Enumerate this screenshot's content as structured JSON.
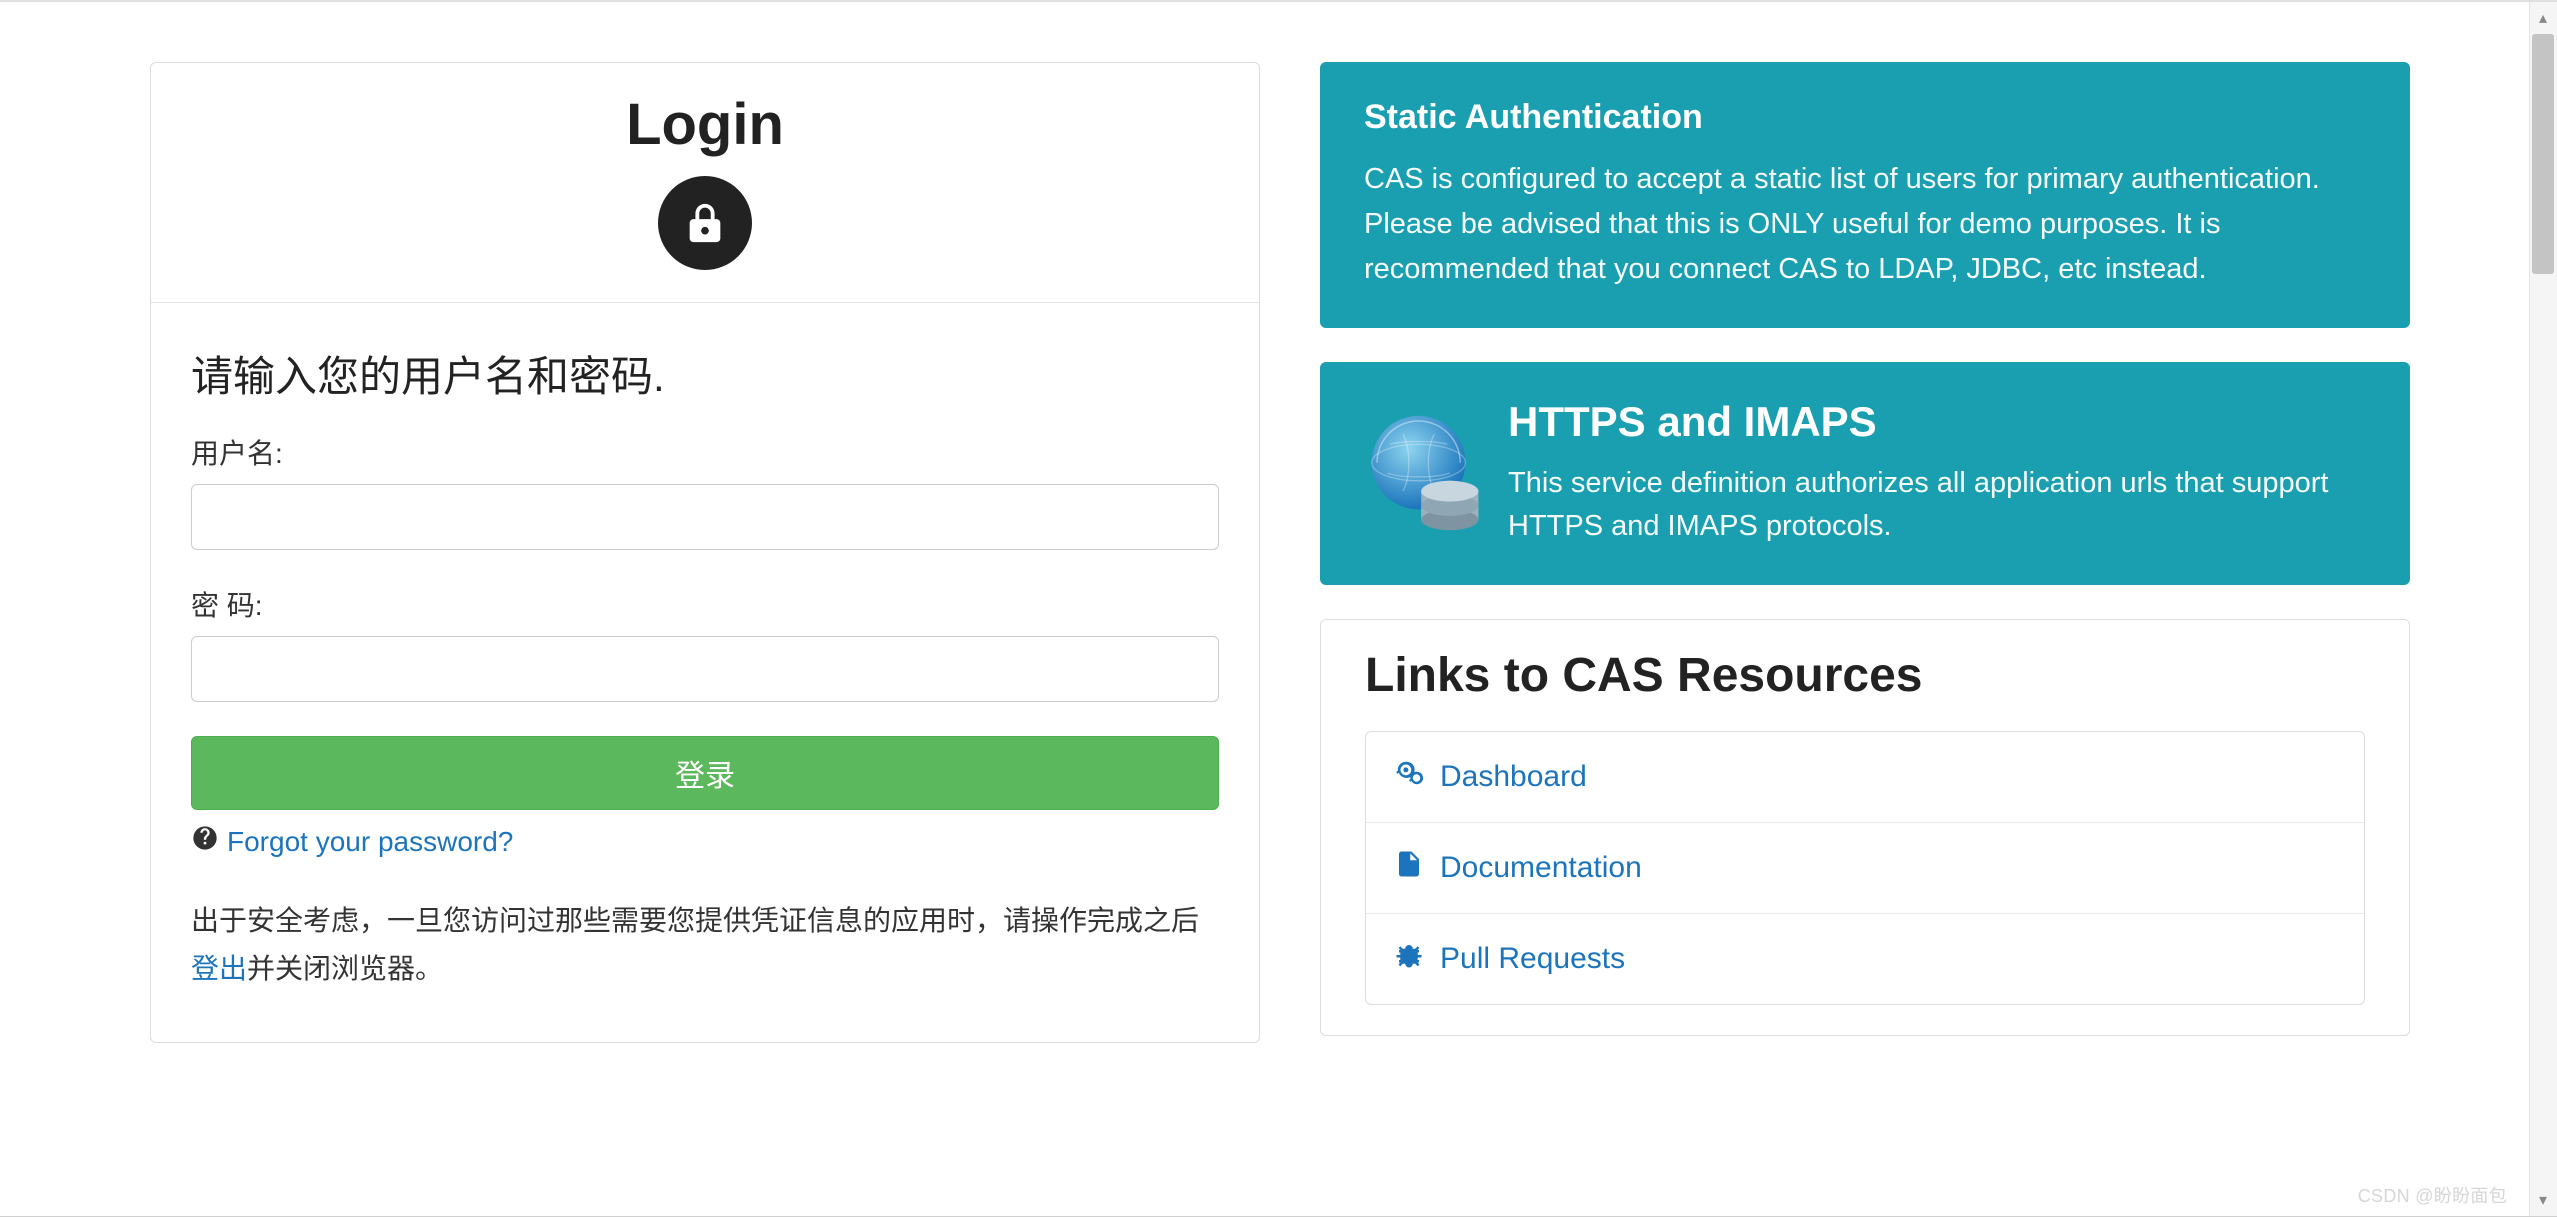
{
  "login": {
    "title": "Login",
    "prompt": "请输入您的用户名和密码.",
    "username_label": "用户名:",
    "password_label": "密   码:",
    "submit_label": "登录",
    "forgot_label": "Forgot your password?",
    "security_note_before": "出于安全考虑，一旦您访问过那些需要您提供凭证信息的应用时，请操作完成之后",
    "security_note_link": "登出",
    "security_note_after": "并关闭浏览器。"
  },
  "alerts": {
    "static_auth": {
      "title": "Static Authentication",
      "body": "CAS is configured to accept a static list of users for primary authentication. Please be advised that this is ONLY useful for demo purposes. It is recommended that you connect CAS to LDAP, JDBC, etc instead."
    },
    "https_imaps": {
      "title": "HTTPS and IMAPS",
      "body": "This service definition authorizes all application urls that support HTTPS and IMAPS protocols."
    }
  },
  "resources": {
    "title": "Links to CAS Resources",
    "items": [
      {
        "label": "Dashboard",
        "icon": "cogs-icon"
      },
      {
        "label": "Documentation",
        "icon": "file-icon"
      },
      {
        "label": "Pull Requests",
        "icon": "bug-icon"
      }
    ]
  },
  "watermark": "CSDN @盼盼面包",
  "colors": {
    "accent_teal": "#1a9fb1",
    "link_blue": "#1c75bc",
    "btn_green": "#5cb85c"
  }
}
